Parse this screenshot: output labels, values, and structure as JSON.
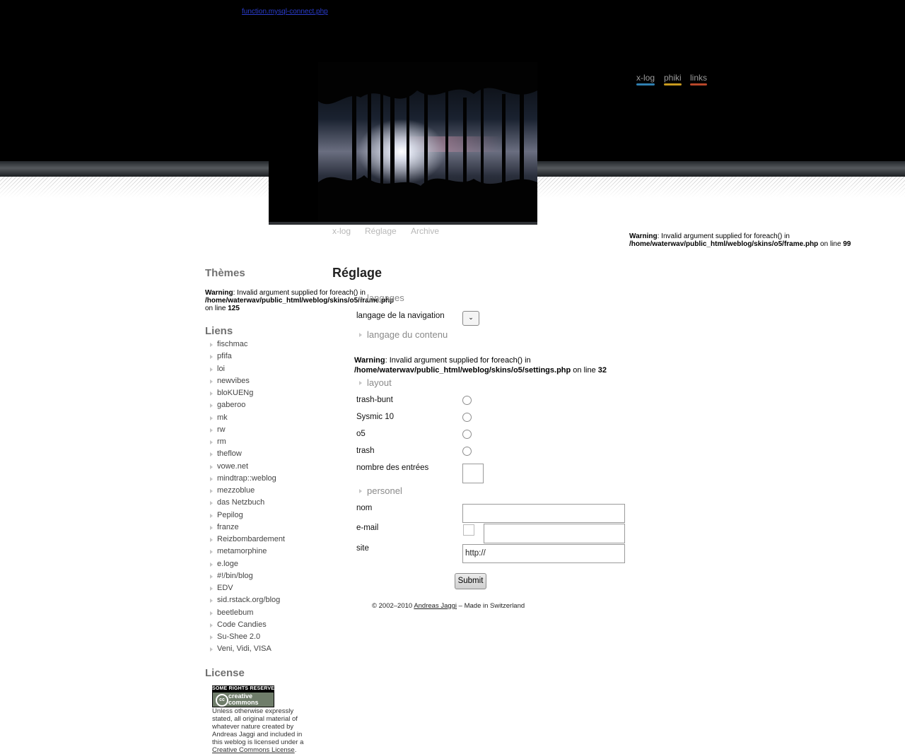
{
  "header": {
    "top_link": "function.mysql-connect.php",
    "nav": [
      {
        "label": "x-log",
        "color": "#2f7fb0"
      },
      {
        "label": "phiki",
        "color": "#c79a1e"
      },
      {
        "label": "links",
        "color": "#b8472a"
      }
    ]
  },
  "subnav": [
    "x-log",
    "Réglage",
    "Archive"
  ],
  "warnings": {
    "top": {
      "label": "Warning",
      "msg": ": Invalid argument supplied for foreach() in ",
      "path": "/home/waterwav/public_html/weblog/skins/o5/frame.php",
      "on_line": " on line ",
      "line": "99"
    },
    "sidebar": {
      "label": "Warning",
      "msg": ": Invalid argument supplied for foreach() in ",
      "path": "/home/waterwav/public_html/weblog/skins/o5/frame.php",
      "on_line": " on line ",
      "line": "125"
    },
    "main": {
      "label": "Warning",
      "msg": ": Invalid argument supplied for foreach() in ",
      "path": "/home/waterwav/public_html/weblog/skins/o5/settings.php",
      "on_line": " on line ",
      "line": "32"
    }
  },
  "sidebar": {
    "themes_title": "Thèmes",
    "links_title": "Liens",
    "links": [
      "fischmac",
      "pfifa",
      "loi",
      "newvibes",
      "bloKUENg",
      "gaberoo",
      "mk",
      "rw",
      "rm",
      "theflow",
      "vowe.net",
      "mindtrap::weblog",
      "mezzoblue",
      "das Netzbuch",
      "Pepilog",
      "franze",
      "Reizbombardement",
      "metamorphine",
      "e.loge",
      "#!/bin/blog",
      "EDV",
      "sid.rstack.org/blog",
      "beetlebum",
      "Code Candies",
      "Su-Shee 2.0",
      "Veni, Vidi, VISA"
    ],
    "license_title": "License",
    "cc_badge": {
      "top": "SOME RIGHTS RESERVED",
      "logo": "cc",
      "word1": "creative",
      "word2": "commons"
    },
    "license_text": "Unless otherwise expressly stated, all original material of whatever nature created by Andreas Jaggi and included in this weblog is licensed under a ",
    "license_link": "Creative Commons License",
    "license_end": "."
  },
  "main": {
    "title": "Réglage",
    "sections": {
      "langages": "langages",
      "content_lang": "langage du contenu",
      "layout": "layout",
      "personel": "personel"
    },
    "nav_lang_label": "langage de la navigation",
    "select_glyph": "⌄",
    "layouts": [
      "trash-bunt",
      "Sysmic 10",
      "o5",
      "trash"
    ],
    "entries_label": "nombre des entrées",
    "nom_label": "nom",
    "email_label": "e-mail",
    "site_label": "site",
    "site_value": "http://",
    "submit": "Submit"
  },
  "footer": {
    "prefix": "© 2002–2010 ",
    "author": "Andreas Jaggi",
    "suffix": " – Made in Switzerland"
  }
}
